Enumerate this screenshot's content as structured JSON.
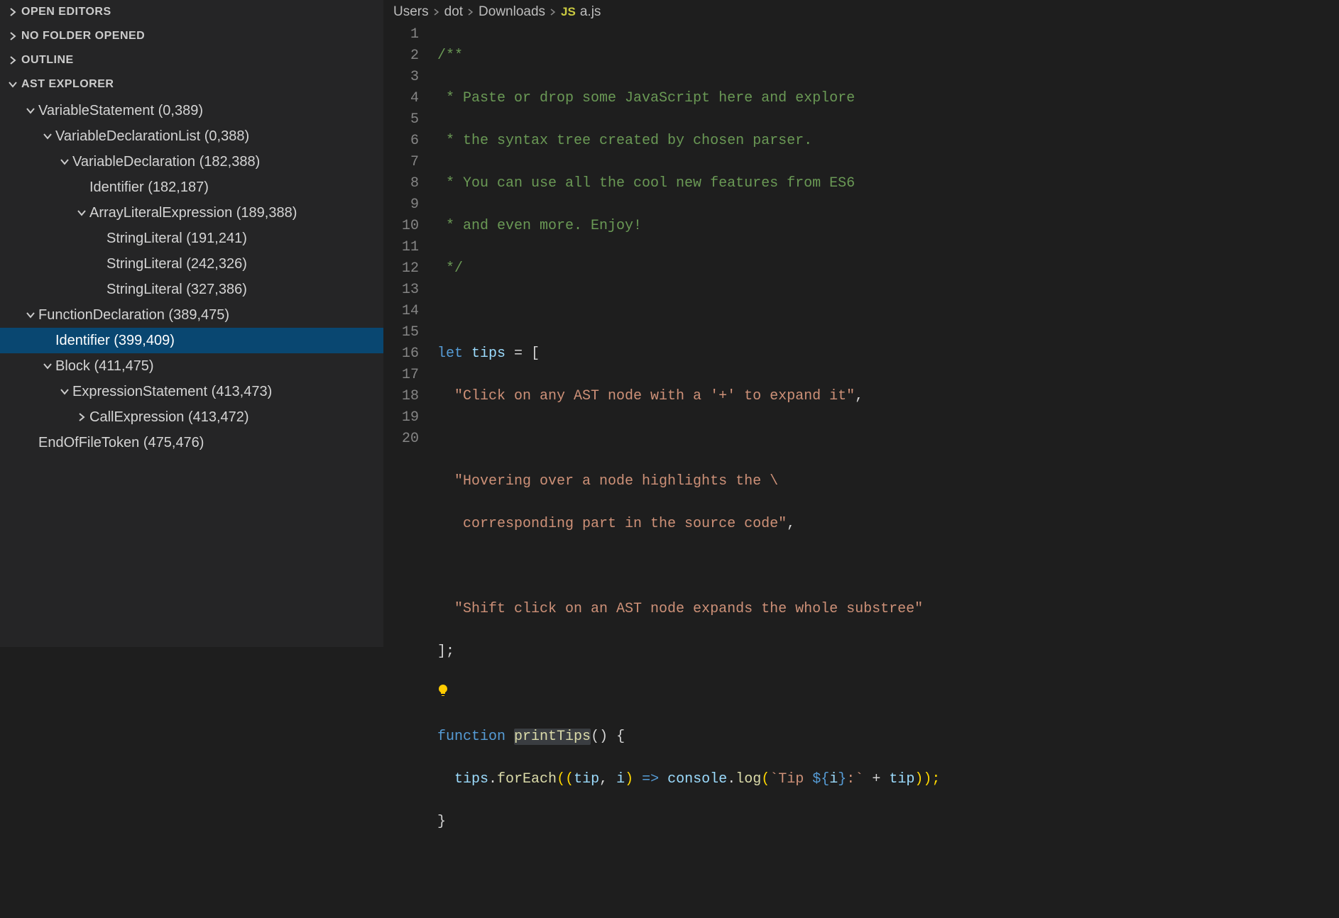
{
  "sidebar": {
    "sections": [
      {
        "label": "OPEN EDITORS",
        "expanded": false
      },
      {
        "label": "NO FOLDER OPENED",
        "expanded": false
      },
      {
        "label": "OUTLINE",
        "expanded": false
      },
      {
        "label": "AST EXPLORER",
        "expanded": true
      }
    ],
    "tree": [
      {
        "indent": 0,
        "arrow": "open",
        "label": "VariableStatement (0,389)",
        "selected": false
      },
      {
        "indent": 1,
        "arrow": "open",
        "label": "VariableDeclarationList (0,388)",
        "selected": false
      },
      {
        "indent": 2,
        "arrow": "open",
        "label": "VariableDeclaration (182,388)",
        "selected": false
      },
      {
        "indent": 3,
        "arrow": "none",
        "label": "Identifier (182,187)",
        "selected": false
      },
      {
        "indent": 3,
        "arrow": "open",
        "label": "ArrayLiteralExpression (189,388)",
        "selected": false
      },
      {
        "indent": 4,
        "arrow": "none",
        "label": "StringLiteral (191,241)",
        "selected": false
      },
      {
        "indent": 4,
        "arrow": "none",
        "label": "StringLiteral (242,326)",
        "selected": false
      },
      {
        "indent": 4,
        "arrow": "none",
        "label": "StringLiteral (327,386)",
        "selected": false
      },
      {
        "indent": 0,
        "arrow": "open",
        "label": "FunctionDeclaration (389,475)",
        "selected": false
      },
      {
        "indent": 1,
        "arrow": "none",
        "label": "Identifier (399,409)",
        "selected": true
      },
      {
        "indent": 1,
        "arrow": "open",
        "label": "Block (411,475)",
        "selected": false
      },
      {
        "indent": 2,
        "arrow": "open",
        "label": "ExpressionStatement (413,473)",
        "selected": false
      },
      {
        "indent": 3,
        "arrow": "closed",
        "label": "CallExpression (413,472)",
        "selected": false
      },
      {
        "indent": 0,
        "arrow": "none",
        "label": "EndOfFileToken (475,476)",
        "selected": false,
        "noindentArrow": true
      }
    ]
  },
  "breadcrumbs": {
    "parts": [
      "Users",
      "dot",
      "Downloads"
    ],
    "fileIcon": "JS",
    "fileName": "a.js"
  },
  "code": {
    "lineCount": 20,
    "lines": {
      "l1": "/**",
      "l2": " * Paste or drop some JavaScript here and explore",
      "l3": " * the syntax tree created by chosen parser.",
      "l4": " * You can use all the cool new features from ES6",
      "l5": " * and even more. Enjoy!",
      "l6": " */",
      "l8_let": "let",
      "l8_tips": "tips",
      "l8_rest": " = [",
      "l9": "  \"Click on any AST node with a '+' to expand it\"",
      "l9_comma": ",",
      "l11": "  \"Hovering over a node highlights the \\",
      "l12": "   corresponding part in the source code\"",
      "l12_comma": ",",
      "l14": "  \"Shift click on an AST node expands the whole substree\"",
      "l15": "];",
      "l17_function": "function",
      "l17_name": "printTips",
      "l17_rest": "() {",
      "l18_tips": "tips",
      "l18_dot1": ".",
      "l18_foreach": "forEach",
      "l18_open": "((",
      "l18_tip": "tip",
      "l18_comma": ", ",
      "l18_i": "i",
      "l18_close1": ") ",
      "l18_arrow": "=>",
      "l18_space": " ",
      "l18_console": "console",
      "l18_dot2": ".",
      "l18_log": "log",
      "l18_open2": "(",
      "l18_tmpl1": "`Tip ",
      "l18_interp_open": "${",
      "l18_i2": "i",
      "l18_interp_close": "}",
      "l18_tmpl2": ":`",
      "l18_plus": " + ",
      "l18_tip2": "tip",
      "l18_close2": "));",
      "l19": "}"
    }
  }
}
